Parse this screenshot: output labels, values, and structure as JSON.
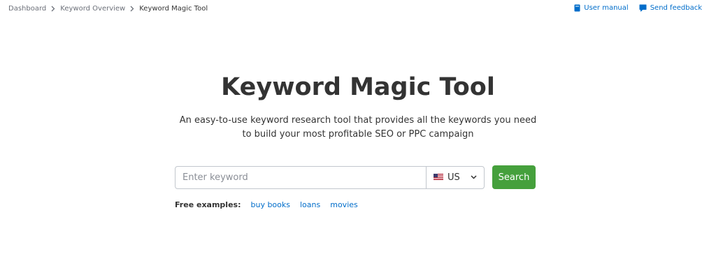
{
  "breadcrumb": {
    "items": [
      "Dashboard",
      "Keyword Overview",
      "Keyword Magic Tool"
    ]
  },
  "top_links": {
    "user_manual": "User manual",
    "send_feedback": "Send feedback"
  },
  "hero": {
    "title": "Keyword Magic Tool",
    "subtitle_line1": "An easy-to-use keyword research tool that provides all the keywords you need",
    "subtitle_line2": "to build your most profitable SEO or PPC campaign"
  },
  "search": {
    "placeholder": "Enter keyword",
    "database": "US",
    "button_label": "Search"
  },
  "examples": {
    "label": "Free examples:",
    "items": [
      "buy books",
      "loans",
      "movies"
    ]
  },
  "colors": {
    "accent_green": "#45a03c",
    "link_blue": "#006dca",
    "text_dark": "#333333",
    "text_muted": "#6c7079"
  },
  "icons": {
    "breadcrumb_separator": "chevron-right-icon",
    "user_manual": "book-icon",
    "send_feedback": "chat-bubble-icon",
    "database": "us-flag-icon",
    "dropdown": "chevron-down-icon"
  }
}
